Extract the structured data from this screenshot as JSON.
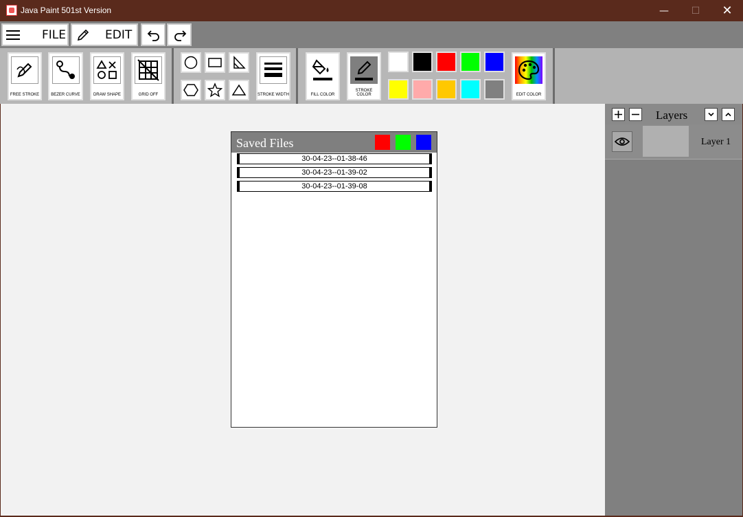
{
  "window": {
    "title": "Java Paint 501st Version",
    "minimize": "—",
    "maximize": "☐",
    "close": "✕"
  },
  "menu": {
    "file_label": "FILE",
    "edit_label": "EDIT"
  },
  "tools": {
    "free_stroke": "FREE STROKE",
    "bezier_curve": "BEZER CURVE",
    "draw_shape": "DRAW SHAPE",
    "grid": "GRID OFF",
    "stroke_width": "STROKE WIDTH",
    "fill_color": "FILL COLOR",
    "stroke_color": "STROKE COLOR",
    "edit_color": "EDIT COLOR"
  },
  "palette": {
    "row1": [
      "#ffffff",
      "#000000",
      "#ff0000",
      "#00ff00",
      "#0000ff"
    ],
    "row2": [
      "#ffff00",
      "#ffaaaa",
      "#ffc800",
      "#00ffff",
      "#808080"
    ]
  },
  "saved_files": {
    "title": "Saved Files",
    "header_swatches": [
      "#ff0000",
      "#00ff00",
      "#0000ff"
    ],
    "files": [
      "30-04-23--01-38-46",
      "30-04-23--01-39-02",
      "30-04-23--01-39-08"
    ]
  },
  "layers": {
    "title": "Layers",
    "items": [
      {
        "name": "Layer 1"
      }
    ]
  }
}
